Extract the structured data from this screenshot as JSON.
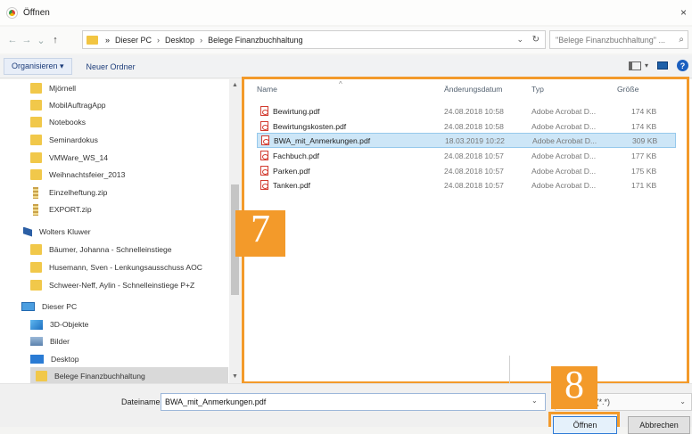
{
  "window": {
    "title": "Öffnen",
    "close": "×"
  },
  "nav": {
    "back": "←",
    "forward": "→",
    "recent": "⌄",
    "up": "↑"
  },
  "address": {
    "crumbs": [
      "Dieser PC",
      "Desktop",
      "Belege Finanzbuchhaltung"
    ],
    "separator": "›",
    "start_separator": "»",
    "dropdown": "⌄",
    "refresh": "↻"
  },
  "search": {
    "placeholder": "\"Belege Finanzbuchhaltung\" ...",
    "icon": "⌕"
  },
  "toolbar": {
    "organize": "Organisieren ▾",
    "new_folder": "Neuer Ordner",
    "view_caret": "▾",
    "help": "?"
  },
  "sidebar": {
    "items": [
      {
        "label": "Mjörnell",
        "icon": "folder"
      },
      {
        "label": "MobilAuftragApp",
        "icon": "folder"
      },
      {
        "label": "Notebooks",
        "icon": "folder"
      },
      {
        "label": "Seminardokus",
        "icon": "folder"
      },
      {
        "label": "VMWare_WS_14",
        "icon": "folder"
      },
      {
        "label": "Weihnachtsfeier_2013",
        "icon": "folder"
      },
      {
        "label": "Einzelheftung.zip",
        "icon": "zip"
      },
      {
        "label": "EXPORT.zip",
        "icon": "zip"
      },
      {
        "label": "Wolters Kluwer",
        "icon": "wk"
      },
      {
        "label": "Bäumer, Johanna - Schnelleinstiege",
        "icon": "folder"
      },
      {
        "label": "Husemann, Sven - Lenkungsausschuss AOC",
        "icon": "folder"
      },
      {
        "label": "Schweer-Neff, Aylin - Schnelleinstiege P+Z",
        "icon": "folder"
      },
      {
        "label": "Dieser PC",
        "icon": "pc"
      },
      {
        "label": "3D-Objekte",
        "icon": "obj3d"
      },
      {
        "label": "Bilder",
        "icon": "pics"
      },
      {
        "label": "Desktop",
        "icon": "desk"
      },
      {
        "label": "Belege Finanzbuchhaltung",
        "icon": "folder",
        "selected": true
      }
    ],
    "scroll_up": "▲",
    "scroll_down": "▼"
  },
  "files": {
    "columns": {
      "name": "Name",
      "date": "Änderungsdatum",
      "type": "Typ",
      "size": "Größe"
    },
    "rows": [
      {
        "name": "Bewirtung.pdf",
        "date": "24.08.2018 10:58",
        "type": "Adobe Acrobat D...",
        "size": "174 KB"
      },
      {
        "name": "Bewirtungskosten.pdf",
        "date": "24.08.2018 10:58",
        "type": "Adobe Acrobat D...",
        "size": "174 KB"
      },
      {
        "name": "BWA_mit_Anmerkungen.pdf",
        "date": "18.03.2019 10:22",
        "type": "Adobe Acrobat D...",
        "size": "309 KB",
        "selected": true
      },
      {
        "name": "Fachbuch.pdf",
        "date": "24.08.2018 10:57",
        "type": "Adobe Acrobat D...",
        "size": "177 KB"
      },
      {
        "name": "Parken.pdf",
        "date": "24.08.2018 10:57",
        "type": "Adobe Acrobat D...",
        "size": "175 KB"
      },
      {
        "name": "Tanken.pdf",
        "date": "24.08.2018 10:57",
        "type": "Adobe Acrobat D...",
        "size": "171 KB"
      }
    ]
  },
  "badges": {
    "seven": "7",
    "eight": "8"
  },
  "bottom": {
    "filename_label": "Dateiname:",
    "filename_value": "BWA_mit_Anmerkungen.pdf",
    "filter_visible": "n (*.*)",
    "dropdown": "⌄",
    "open_label": "Öffnen",
    "cancel_label": "Abbrechen"
  },
  "colors": {
    "accent": "#f39a2a",
    "selection": "#cde6f7"
  }
}
